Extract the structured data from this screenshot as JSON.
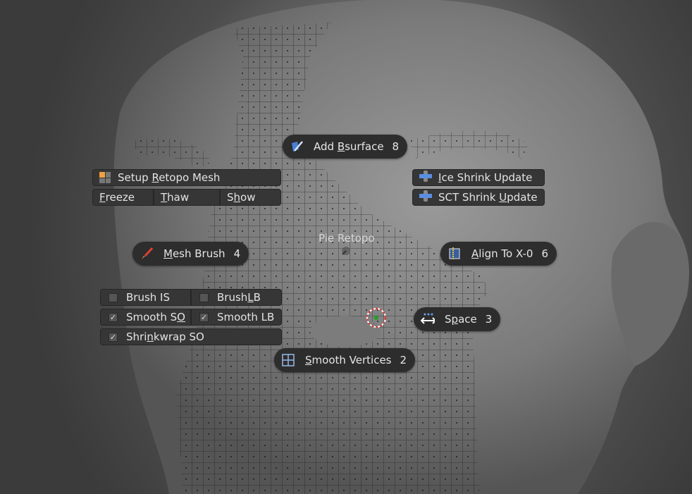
{
  "pie_menu": {
    "title": "Pie Retopo",
    "items": {
      "north": {
        "pre": "Add ",
        "u": "B",
        "post": "surface",
        "key": "8",
        "icon": "bsurface-icon"
      },
      "west": {
        "pre": "",
        "u": "M",
        "post": "esh Brush",
        "key": "4",
        "icon": "paint-brush-icon"
      },
      "east": {
        "pre": "",
        "u": "A",
        "post": "lign To X-0",
        "key": "6",
        "icon": "align-x-icon"
      },
      "south": {
        "pre": "",
        "u": "S",
        "post": "mooth Vertices",
        "key": "2",
        "icon": "grid-icon"
      },
      "southeast": {
        "pre": "S",
        "u": "p",
        "post": "ace",
        "key": "3",
        "icon": "space-arrows-icon"
      }
    },
    "northwest": {
      "setup": {
        "pre": "Setup ",
        "u": "R",
        "post": "etopo Mesh",
        "icon": "setup-mesh-icon"
      },
      "freeze": {
        "pre": "",
        "u": "F",
        "post": "reeze"
      },
      "thaw": {
        "pre": "",
        "u": "T",
        "post": "haw"
      },
      "show": {
        "pre": "S",
        "u": "h",
        "post": "ow"
      }
    },
    "northeast": {
      "ice": {
        "pre": "",
        "u": "I",
        "post": "ce Shrink Update",
        "icon": "shrinkwrap-icon"
      },
      "sct": {
        "pre": "SCT Shrink ",
        "u": "U",
        "post": "pdate",
        "icon": "shrinkwrap-icon"
      }
    },
    "southwest": {
      "brush_is": {
        "label": "Brush IS",
        "checked": false
      },
      "brush_lb": {
        "pre": "Brush ",
        "u": "L",
        "post": "B",
        "checked": false
      },
      "smooth_so": {
        "pre": "Smooth S",
        "u": "O",
        "post": "",
        "checked": true
      },
      "smooth_lb": {
        "label": "Smooth LB",
        "checked": true
      },
      "shrinkwrap_so": {
        "pre": "Shri",
        "u": "n",
        "post": "kwrap SO",
        "checked": true
      }
    }
  },
  "colors": {
    "menu_bg": "#2d2d2d",
    "button_bg": "#363636",
    "text": "#e6e6e6",
    "cursor_ring": "#ffffff",
    "cursor_dash": "#d03030",
    "cursor_center": "#22a022"
  }
}
